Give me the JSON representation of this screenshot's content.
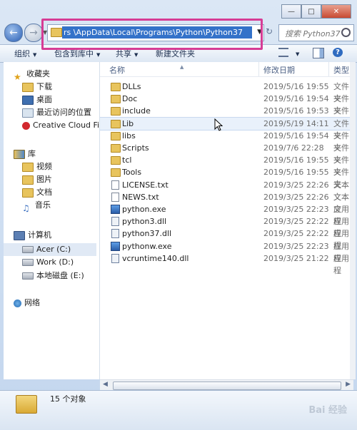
{
  "address": {
    "path": "rs            \\AppData\\Local\\Programs\\Python\\Python37"
  },
  "search": {
    "placeholder": "搜索 Python37"
  },
  "toolbar": {
    "organize": "组织",
    "include_in_library": "包含到库中",
    "share": "共享",
    "new_folder": "新建文件夹"
  },
  "sidebar": {
    "favorites": "收藏夹",
    "downloads": "下载",
    "desktop": "桌面",
    "recent": "最近访问的位置",
    "creative_cloud": "Creative Cloud File",
    "libraries": "库",
    "videos": "视频",
    "pictures": "图片",
    "documents": "文档",
    "music": "音乐",
    "computer": "计算机",
    "drive_c": "Acer (C:)",
    "drive_d": "Work (D:)",
    "drive_e": "本地磁盘 (E:)",
    "network": "网络"
  },
  "columns": {
    "name": "名称",
    "date": "修改日期",
    "type": "类型"
  },
  "files": [
    {
      "name": "DLLs",
      "date": "2019/5/16 19:55",
      "type": "文件夹",
      "kind": "folder"
    },
    {
      "name": "Doc",
      "date": "2019/5/16 19:54",
      "type": "文件夹",
      "kind": "folder"
    },
    {
      "name": "include",
      "date": "2019/5/16 19:53",
      "type": "文件夹",
      "kind": "folder"
    },
    {
      "name": "Lib",
      "date": "2019/5/19 14:11",
      "type": "文件夹",
      "kind": "folder"
    },
    {
      "name": "libs",
      "date": "2019/5/16 19:54",
      "type": "文件夹",
      "kind": "folder"
    },
    {
      "name": "Scripts",
      "date": "2019/7/6 22:28",
      "type": "文件夹",
      "kind": "folder"
    },
    {
      "name": "tcl",
      "date": "2019/5/16 19:55",
      "type": "文件夹",
      "kind": "folder"
    },
    {
      "name": "Tools",
      "date": "2019/5/16 19:55",
      "type": "文件夹",
      "kind": "folder"
    },
    {
      "name": "LICENSE.txt",
      "date": "2019/3/25 22:26",
      "type": "文本文",
      "kind": "doc"
    },
    {
      "name": "NEWS.txt",
      "date": "2019/3/25 22:26",
      "type": "文本文",
      "kind": "doc"
    },
    {
      "name": "python.exe",
      "date": "2019/3/25 22:23",
      "type": "应用程",
      "kind": "exe"
    },
    {
      "name": "python3.dll",
      "date": "2019/3/25 22:22",
      "type": "应用程",
      "kind": "dll"
    },
    {
      "name": "python37.dll",
      "date": "2019/3/25 22:22",
      "type": "应用程",
      "kind": "dll"
    },
    {
      "name": "pythonw.exe",
      "date": "2019/3/25 22:23",
      "type": "应用程",
      "kind": "exe"
    },
    {
      "name": "vcruntime140.dll",
      "date": "2019/3/25 21:22",
      "type": "应用程",
      "kind": "dll"
    }
  ],
  "status": {
    "count": "15 个对象"
  },
  "watermark": "Bai 经验"
}
